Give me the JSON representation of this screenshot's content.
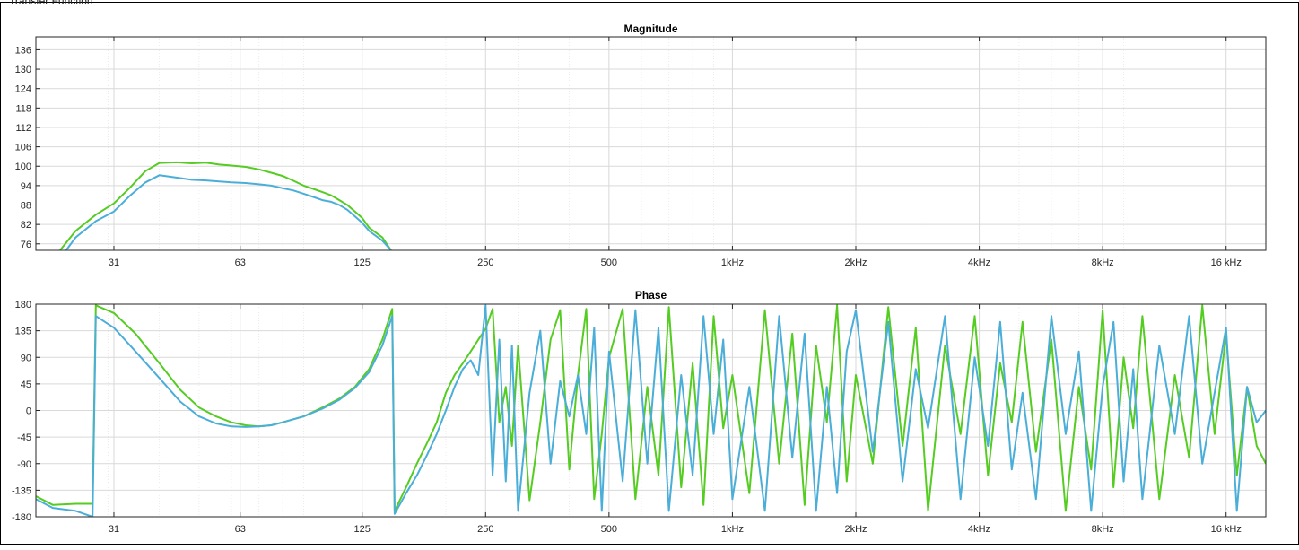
{
  "window": {
    "panel_title": "Transfer Function"
  },
  "colors": {
    "series_green": "#55cc22",
    "series_blue": "#4aaed8",
    "grid": "#d9d9d9",
    "axis": "#262626"
  },
  "chart_data": [
    {
      "type": "line",
      "title": "Magnitude",
      "x_scale": "log",
      "xlim": [
        20,
        20000
      ],
      "ylim": [
        74,
        140
      ],
      "grid": true,
      "x_ticks": [
        31,
        63,
        125,
        250,
        500,
        1000,
        2000,
        4000,
        8000,
        16000
      ],
      "x_tick_labels": [
        "31",
        "63",
        "125",
        "250",
        "500",
        "1kHz",
        "2kHz",
        "4kHz",
        "8kHz",
        "16 kHz"
      ],
      "y_ticks": [
        76,
        82,
        88,
        94,
        100,
        106,
        112,
        118,
        124,
        130,
        136
      ],
      "series": [
        {
          "color": "#55cc22",
          "x": [
            22.9,
            25,
            28,
            31,
            34,
            37,
            40,
            44,
            48,
            52,
            56,
            60,
            65,
            70,
            75,
            80,
            85,
            90,
            95,
            100,
            105,
            110,
            115,
            120,
            125,
            130,
            140,
            147
          ],
          "y": [
            74,
            80,
            85,
            88.5,
            93.5,
            98.5,
            101,
            101.2,
            100.9,
            101.1,
            100.5,
            100.2,
            99.8,
            99,
            98,
            97,
            95.5,
            94,
            93,
            92,
            91,
            89.5,
            88,
            86,
            84,
            81,
            78,
            74
          ]
        },
        {
          "color": "#4aaed8",
          "x": [
            23.7,
            25,
            28,
            31,
            34,
            37,
            40,
            44,
            48,
            52,
            56,
            60,
            65,
            70,
            75,
            80,
            85,
            90,
            95,
            100,
            105,
            110,
            115,
            120,
            125,
            130,
            140,
            147
          ],
          "y": [
            74,
            78,
            83,
            86,
            91,
            95,
            97.2,
            96.5,
            95.8,
            95.6,
            95.3,
            95,
            94.8,
            94.4,
            94,
            93.2,
            92.5,
            91.5,
            90.5,
            89.5,
            89,
            88,
            86.5,
            84.5,
            82.5,
            80,
            77,
            74
          ]
        }
      ]
    },
    {
      "type": "line",
      "title": "Phase",
      "x_scale": "log",
      "xlim": [
        20,
        20000
      ],
      "ylim": [
        -180,
        180
      ],
      "grid": true,
      "x_ticks": [
        31,
        63,
        125,
        250,
        500,
        1000,
        2000,
        4000,
        8000,
        16000
      ],
      "x_tick_labels": [
        "31",
        "63",
        "125",
        "250",
        "500",
        "1kHz",
        "2kHz",
        "4kHz",
        "8kHz",
        "16 kHz"
      ],
      "y_ticks": [
        -180,
        -135,
        -90,
        -45,
        0,
        45,
        90,
        135,
        180
      ],
      "series": [
        {
          "color": "#55cc22",
          "x": [
            20,
            22,
            25,
            27.5,
            28,
            31,
            35,
            40,
            45,
            50,
            55,
            60,
            65,
            70,
            75,
            80,
            90,
            100,
            110,
            120,
            130,
            140,
            148,
            150,
            160,
            170,
            180,
            190,
            200,
            210,
            220,
            230,
            240,
            250,
            260,
            270,
            280,
            290,
            300,
            320,
            340,
            360,
            380,
            400,
            420,
            440,
            460,
            480,
            500,
            540,
            580,
            620,
            660,
            700,
            750,
            800,
            850,
            900,
            950,
            1000,
            1100,
            1200,
            1300,
            1400,
            1500,
            1600,
            1700,
            1800,
            1900,
            2000,
            2200,
            2400,
            2600,
            2800,
            3000,
            3300,
            3600,
            3900,
            4200,
            4500,
            4800,
            5100,
            5500,
            6000,
            6500,
            7000,
            7500,
            8000,
            8500,
            9000,
            9500,
            10000,
            11000,
            12000,
            13000,
            14000,
            15000,
            16000,
            17000,
            18000,
            19000,
            20000
          ],
          "y": [
            -145,
            -160,
            -158,
            -158,
            178,
            165,
            130,
            80,
            35,
            5,
            -10,
            -20,
            -25,
            -27,
            -25,
            -20,
            -10,
            5,
            20,
            40,
            70,
            120,
            172,
            -170,
            -130,
            -90,
            -55,
            -20,
            30,
            60,
            80,
            100,
            120,
            138,
            172,
            -20,
            40,
            -60,
            110,
            -152,
            -20,
            120,
            170,
            -100,
            60,
            172,
            -150,
            -40,
            90,
            172,
            -150,
            40,
            -110,
            175,
            -130,
            80,
            -160,
            160,
            -30,
            60,
            -140,
            170,
            -90,
            130,
            -160,
            110,
            -20,
            178,
            -120,
            60,
            -90,
            175,
            -60,
            140,
            -170,
            110,
            -40,
            160,
            -110,
            80,
            -20,
            150,
            -70,
            120,
            -170,
            40,
            -100,
            170,
            -130,
            90,
            -30,
            160,
            -150,
            60,
            -80,
            178,
            -40,
            130,
            -110,
            40,
            -60,
            -90
          ]
        },
        {
          "color": "#4aaed8",
          "x": [
            20,
            22,
            25,
            27.5,
            28,
            31,
            35,
            40,
            45,
            50,
            55,
            60,
            65,
            70,
            75,
            80,
            90,
            100,
            110,
            120,
            130,
            140,
            148,
            150,
            160,
            170,
            180,
            190,
            200,
            210,
            220,
            230,
            240,
            250,
            260,
            270,
            280,
            290,
            300,
            320,
            340,
            360,
            380,
            400,
            420,
            440,
            460,
            480,
            500,
            540,
            580,
            620,
            660,
            700,
            750,
            800,
            850,
            900,
            950,
            1000,
            1100,
            1200,
            1300,
            1400,
            1500,
            1600,
            1700,
            1800,
            1900,
            2000,
            2200,
            2400,
            2600,
            2800,
            3000,
            3300,
            3600,
            3900,
            4200,
            4500,
            4800,
            5100,
            5500,
            6000,
            6500,
            7000,
            7500,
            8000,
            8500,
            9000,
            9500,
            10000,
            11000,
            12000,
            13000,
            14000,
            15000,
            16000,
            17000,
            18000,
            19000,
            20000
          ],
          "y": [
            -150,
            -165,
            -170,
            -180,
            160,
            140,
            100,
            55,
            15,
            -10,
            -22,
            -27,
            -28,
            -27,
            -25,
            -20,
            -10,
            3,
            18,
            38,
            65,
            110,
            160,
            -175,
            -140,
            -110,
            -75,
            -40,
            0,
            40,
            70,
            85,
            60,
            178,
            -110,
            120,
            -120,
            110,
            -170,
            30,
            135,
            -90,
            50,
            -10,
            60,
            -40,
            140,
            -170,
            100,
            -120,
            170,
            -90,
            140,
            -170,
            60,
            -110,
            160,
            -40,
            120,
            -150,
            40,
            -170,
            160,
            -80,
            130,
            -170,
            40,
            -140,
            100,
            170,
            -70,
            150,
            -120,
            70,
            -30,
            160,
            -150,
            90,
            -60,
            150,
            -100,
            30,
            -150,
            160,
            -40,
            100,
            -170,
            40,
            150,
            -120,
            70,
            -150,
            110,
            -40,
            160,
            -90,
            30,
            140,
            -170,
            40,
            -20,
            0
          ]
        }
      ]
    }
  ]
}
